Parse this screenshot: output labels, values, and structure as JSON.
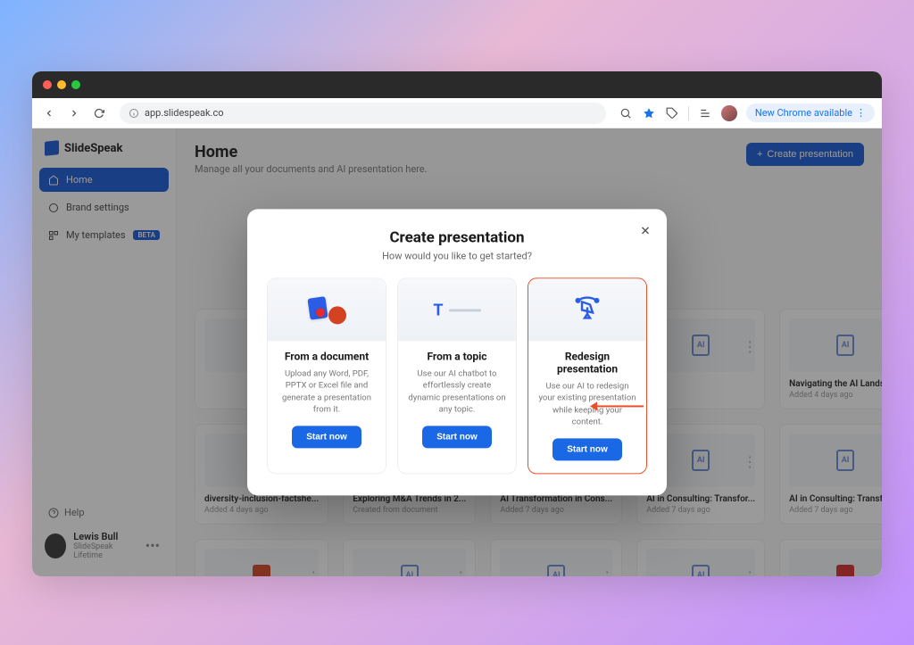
{
  "browser": {
    "url": "app.slidespeak.co",
    "update_pill": "New Chrome available"
  },
  "sidebar": {
    "brand": "SlideSpeak",
    "items": [
      {
        "label": "Home",
        "active": true
      },
      {
        "label": "Brand settings",
        "active": false
      },
      {
        "label": "My templates",
        "active": false,
        "badge": "BETA"
      }
    ],
    "help": "Help",
    "user": {
      "name": "Lewis Bull",
      "plan": "SlideSpeak Lifetime"
    }
  },
  "main": {
    "title": "Home",
    "subtitle": "Manage all your documents and AI presentation here.",
    "create_button": "Create presentation"
  },
  "documents": [
    {
      "title": "",
      "meta": "",
      "icon": "ai"
    },
    {
      "title": "",
      "meta": "",
      "icon": "ai"
    },
    {
      "title": "",
      "meta": "",
      "icon": "ai"
    },
    {
      "title": "",
      "meta": "",
      "icon": "ai"
    },
    {
      "title": "Navigating the AI Landsca...",
      "meta": "Added 4 days ago",
      "icon": "ai"
    },
    {
      "title": "diversity-inclusion-factshe...",
      "meta": "Added 4 days ago",
      "icon": "pp"
    },
    {
      "title": "Exploring M&A Trends in 2...",
      "meta": "Created from document",
      "icon": "ai"
    },
    {
      "title": "AI Transformation in Cons...",
      "meta": "Added 7 days ago",
      "icon": "ai"
    },
    {
      "title": "AI in Consulting: Transfor...",
      "meta": "Added 7 days ago",
      "icon": "ai"
    },
    {
      "title": "AI in Consulting: Transfor...",
      "meta": "Added 7 days ago",
      "icon": "ai"
    },
    {
      "title": "",
      "meta": "",
      "icon": "pp"
    },
    {
      "title": "",
      "meta": "",
      "icon": "ai"
    },
    {
      "title": "",
      "meta": "",
      "icon": "ai"
    },
    {
      "title": "",
      "meta": "",
      "icon": "ai"
    },
    {
      "title": "",
      "meta": "",
      "icon": "pdf"
    }
  ],
  "modal": {
    "title": "Create presentation",
    "subtitle": "How would you like to get started?",
    "options": [
      {
        "title": "From a document",
        "desc": "Upload any Word, PDF, PPTX or Excel file and generate a presentation from it.",
        "button": "Start now"
      },
      {
        "title": "From a topic",
        "desc": "Use our AI chatbot to effortlessly create dynamic presentations on any topic.",
        "button": "Start now"
      },
      {
        "title": "Redesign presentation",
        "desc": "Use our AI to redesign your existing presentation while keeping your content.",
        "button": "Start now"
      }
    ]
  }
}
